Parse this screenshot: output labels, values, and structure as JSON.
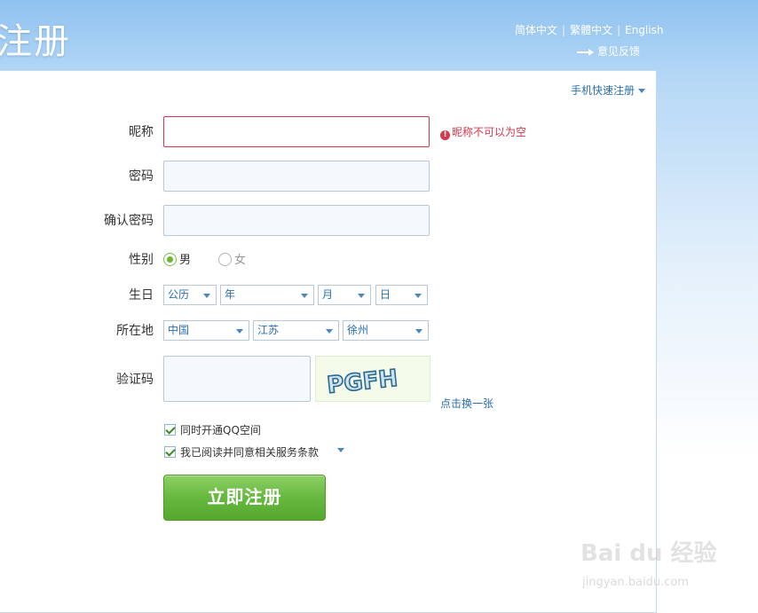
{
  "header": {
    "title": "注册",
    "languages": [
      "简体中文",
      "繁體中文",
      "English"
    ],
    "feedback": "意见反馈"
  },
  "panel": {
    "mobile_link": "手机快速注册"
  },
  "form": {
    "nickname": {
      "label": "昵称",
      "value": "",
      "error": "昵称不可以为空"
    },
    "password": {
      "label": "密码",
      "value": ""
    },
    "confirm": {
      "label": "确认密码",
      "value": ""
    },
    "gender": {
      "label": "性别",
      "options": [
        "男",
        "女"
      ],
      "selected": "男"
    },
    "birthday": {
      "label": "生日",
      "calendar": "公历",
      "year": "年",
      "month": "月",
      "day": "日"
    },
    "location": {
      "label": "所在地",
      "country": "中国",
      "province": "江苏",
      "city": "徐州"
    },
    "captcha": {
      "label": "验证码",
      "value": "",
      "image_text": "PGFH",
      "refresh": "点击换一张"
    },
    "checkboxes": [
      {
        "label": "同时开通QQ空间",
        "checked": true
      },
      {
        "label": "我已阅读并同意相关服务条款",
        "checked": true
      }
    ],
    "submit": "立即注册"
  },
  "watermark": {
    "brand": "Bai du 经验",
    "url": "jingyan.baidu.com"
  },
  "colors": {
    "error": "#d6384d",
    "link": "#2a6fb0",
    "button": "#66b83e"
  }
}
